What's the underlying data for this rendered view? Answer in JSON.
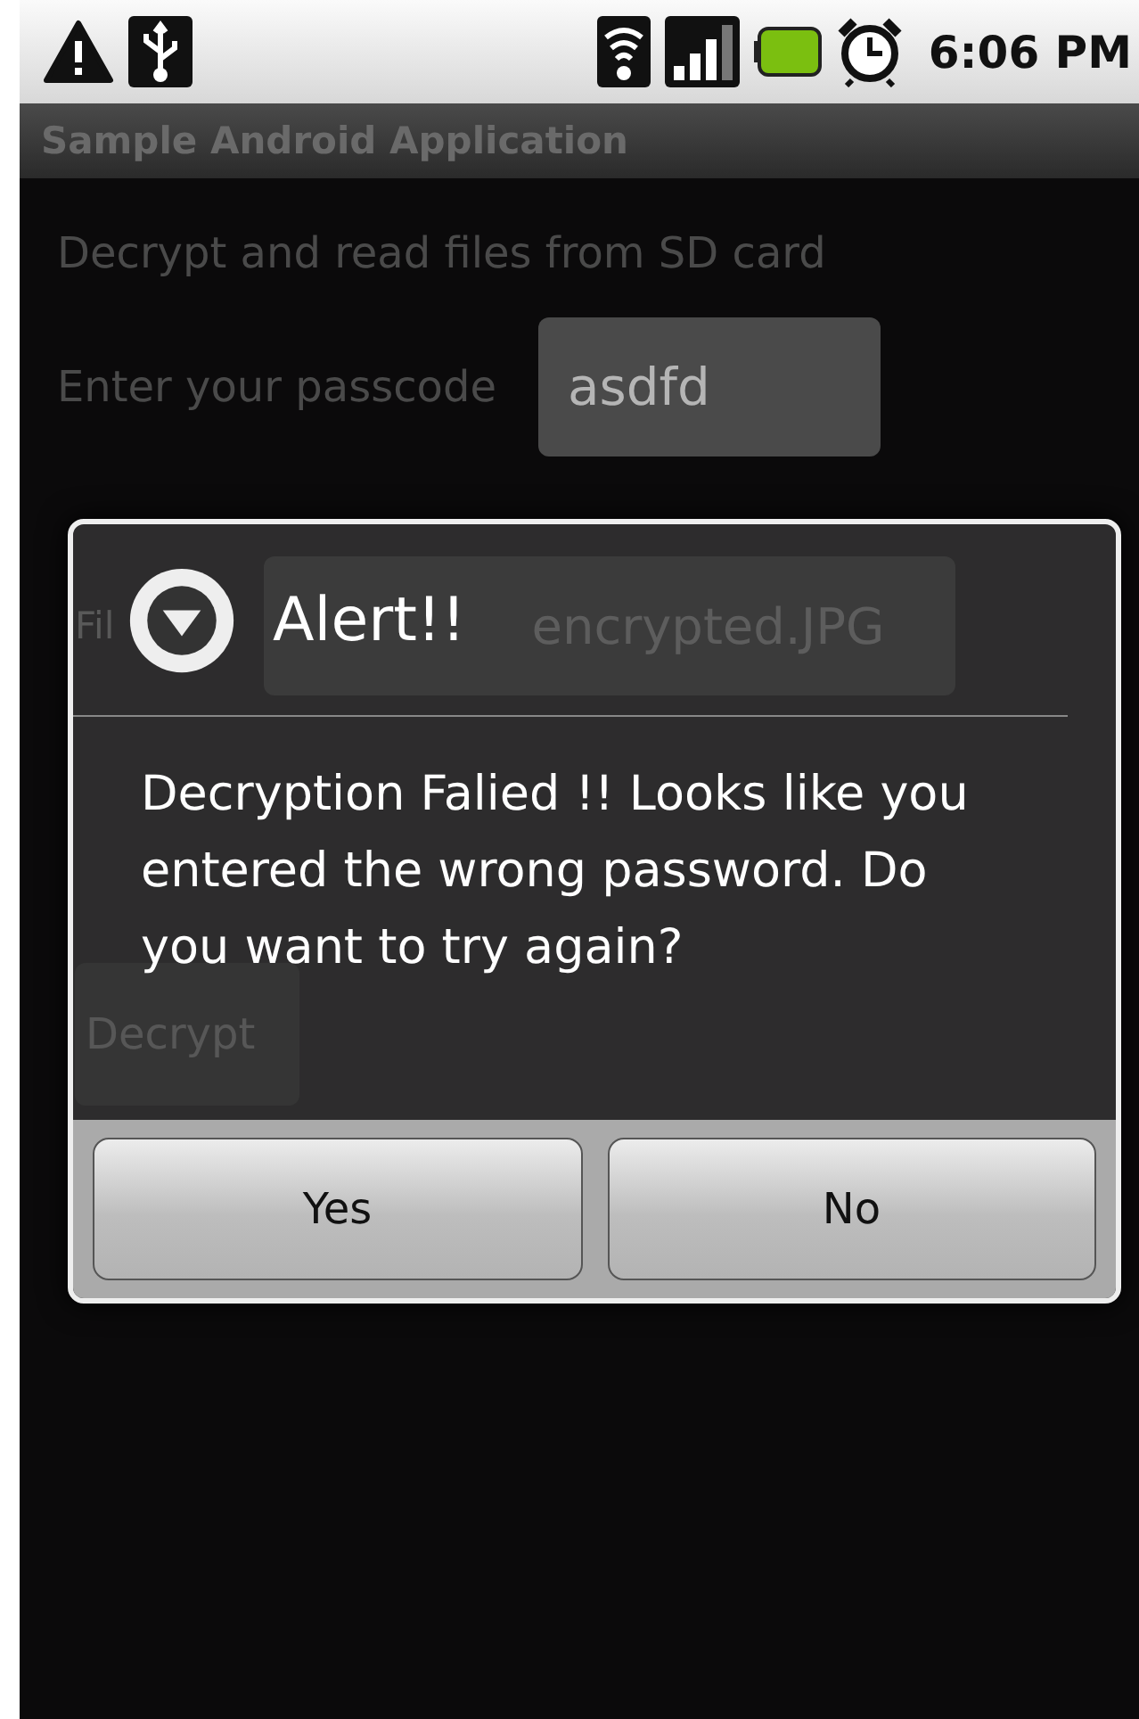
{
  "status_bar": {
    "time": "6:06 PM"
  },
  "app": {
    "title": "Sample Android Application",
    "description": "Decrypt and read files from SD card",
    "passcode_label": "Enter your passcode",
    "passcode_value": "asdfd",
    "file_label": "Fil",
    "file_value": "encrypted.JPG",
    "decrypt_button": "Decrypt"
  },
  "dialog": {
    "title": "Alert!!",
    "message": "Decryption Falied !! Looks like you entered the wrong password. Do you want to try again?",
    "buttons": [
      "Yes",
      "No"
    ]
  }
}
